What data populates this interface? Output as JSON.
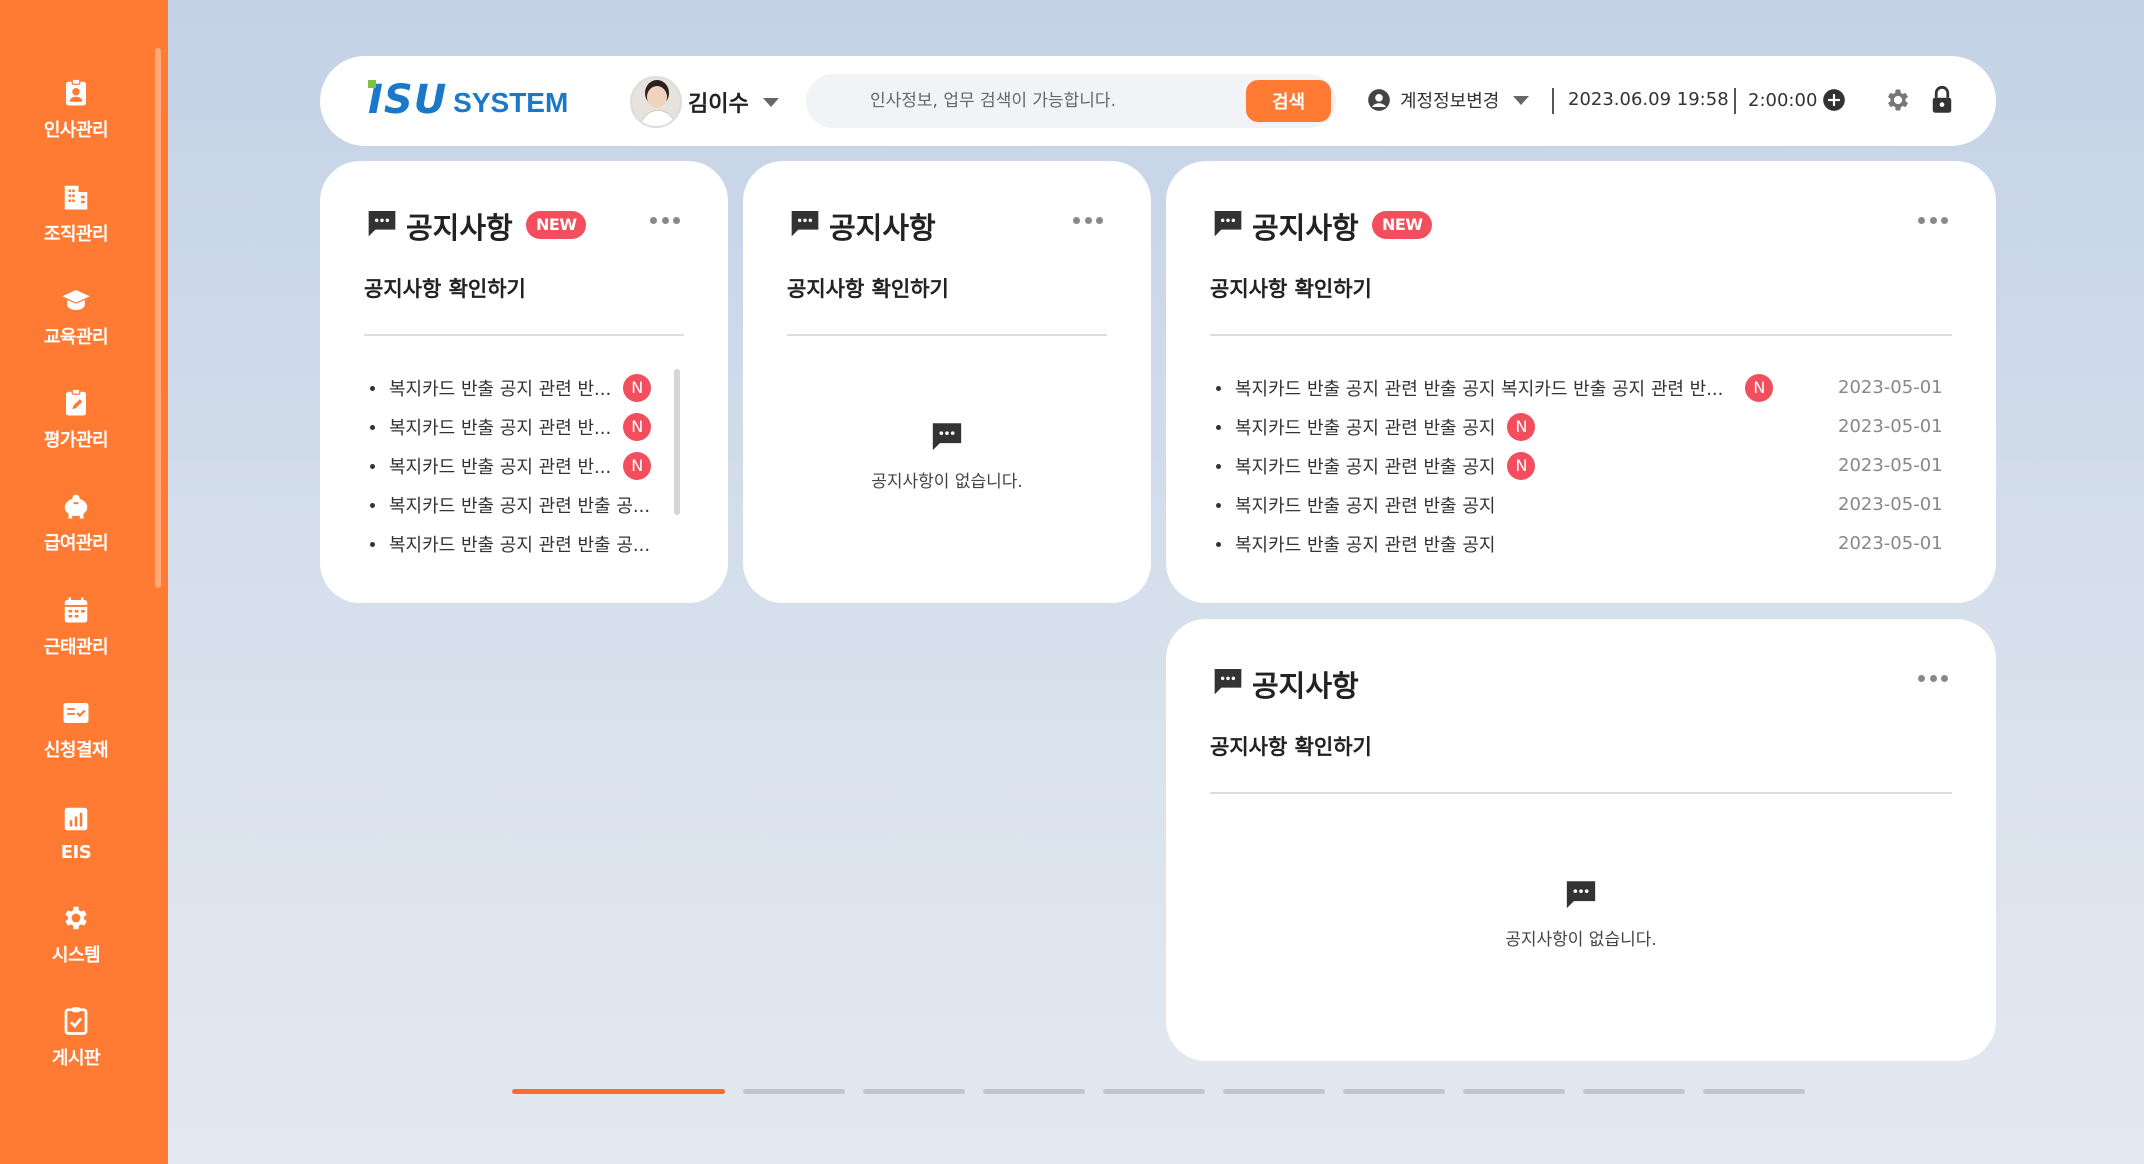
{
  "sidebar": {
    "items": [
      {
        "label": "인사관리",
        "icon": "id-badge-icon"
      },
      {
        "label": "조직관리",
        "icon": "building-icon"
      },
      {
        "label": "교육관리",
        "icon": "graduation-cap-icon"
      },
      {
        "label": "평가관리",
        "icon": "clipboard-edit-icon"
      },
      {
        "label": "급여관리",
        "icon": "piggy-bank-icon"
      },
      {
        "label": "근태관리",
        "icon": "calendar-icon"
      },
      {
        "label": "신청결재",
        "icon": "approval-icon"
      },
      {
        "label": "EIS",
        "icon": "chart-icon"
      },
      {
        "label": "시스템",
        "icon": "gear-icon"
      },
      {
        "label": "게시판",
        "icon": "clipboard-check-icon"
      }
    ]
  },
  "header": {
    "logo_main": "ISU",
    "logo_sub": "SYSTEM",
    "user_name": "김이수",
    "search_placeholder": "인사정보, 업무 검색이 가능합니다.",
    "search_button": "검색",
    "account_label": "계정정보변경",
    "datetime": "2023.06.09 19:58",
    "timer": "2:00:00"
  },
  "cards": [
    {
      "title": "공지사항",
      "badge": "NEW",
      "subtitle": "공지사항 확인하기",
      "items": [
        {
          "text": "복지카드 반출 공지 관련 반...",
          "new": "N"
        },
        {
          "text": "복지카드 반출 공지 관련 반...",
          "new": "N"
        },
        {
          "text": "복지카드 반출 공지 관련 반...",
          "new": "N"
        },
        {
          "text": "복지카드 반출 공지 관련 반출 공..."
        },
        {
          "text": "복지카드 반출 공지 관련 반출 공..."
        }
      ]
    },
    {
      "title": "공지사항",
      "subtitle": "공지사항 확인하기",
      "empty": "공지사항이 없습니다."
    },
    {
      "title": "공지사항",
      "badge": "NEW",
      "subtitle": "공지사항 확인하기",
      "items": [
        {
          "text": "복지카드 반출 공지 관련 반출 공지 복지카드 반출 공지 관련 반...",
          "new": "N",
          "date": "2023-05-01"
        },
        {
          "text": "복지카드 반출 공지 관련 반출 공지",
          "new": "N",
          "date": "2023-05-01"
        },
        {
          "text": "복지카드 반출 공지 관련 반출 공지",
          "new": "N",
          "date": "2023-05-01"
        },
        {
          "text": "복지카드 반출 공지 관련 반출 공지",
          "date": "2023-05-01"
        },
        {
          "text": "복지카드 반출 공지 관련 반출 공지",
          "date": "2023-05-01"
        }
      ]
    },
    {
      "title": "공지사항",
      "subtitle": "공지사항 확인하기",
      "empty": "공지사항이 없습니다."
    }
  ],
  "pager": {
    "pages": 10,
    "current": 1
  },
  "colors": {
    "accent": "#ff7a33",
    "badge": "#f24e5e",
    "logo": "#1a78c8"
  }
}
